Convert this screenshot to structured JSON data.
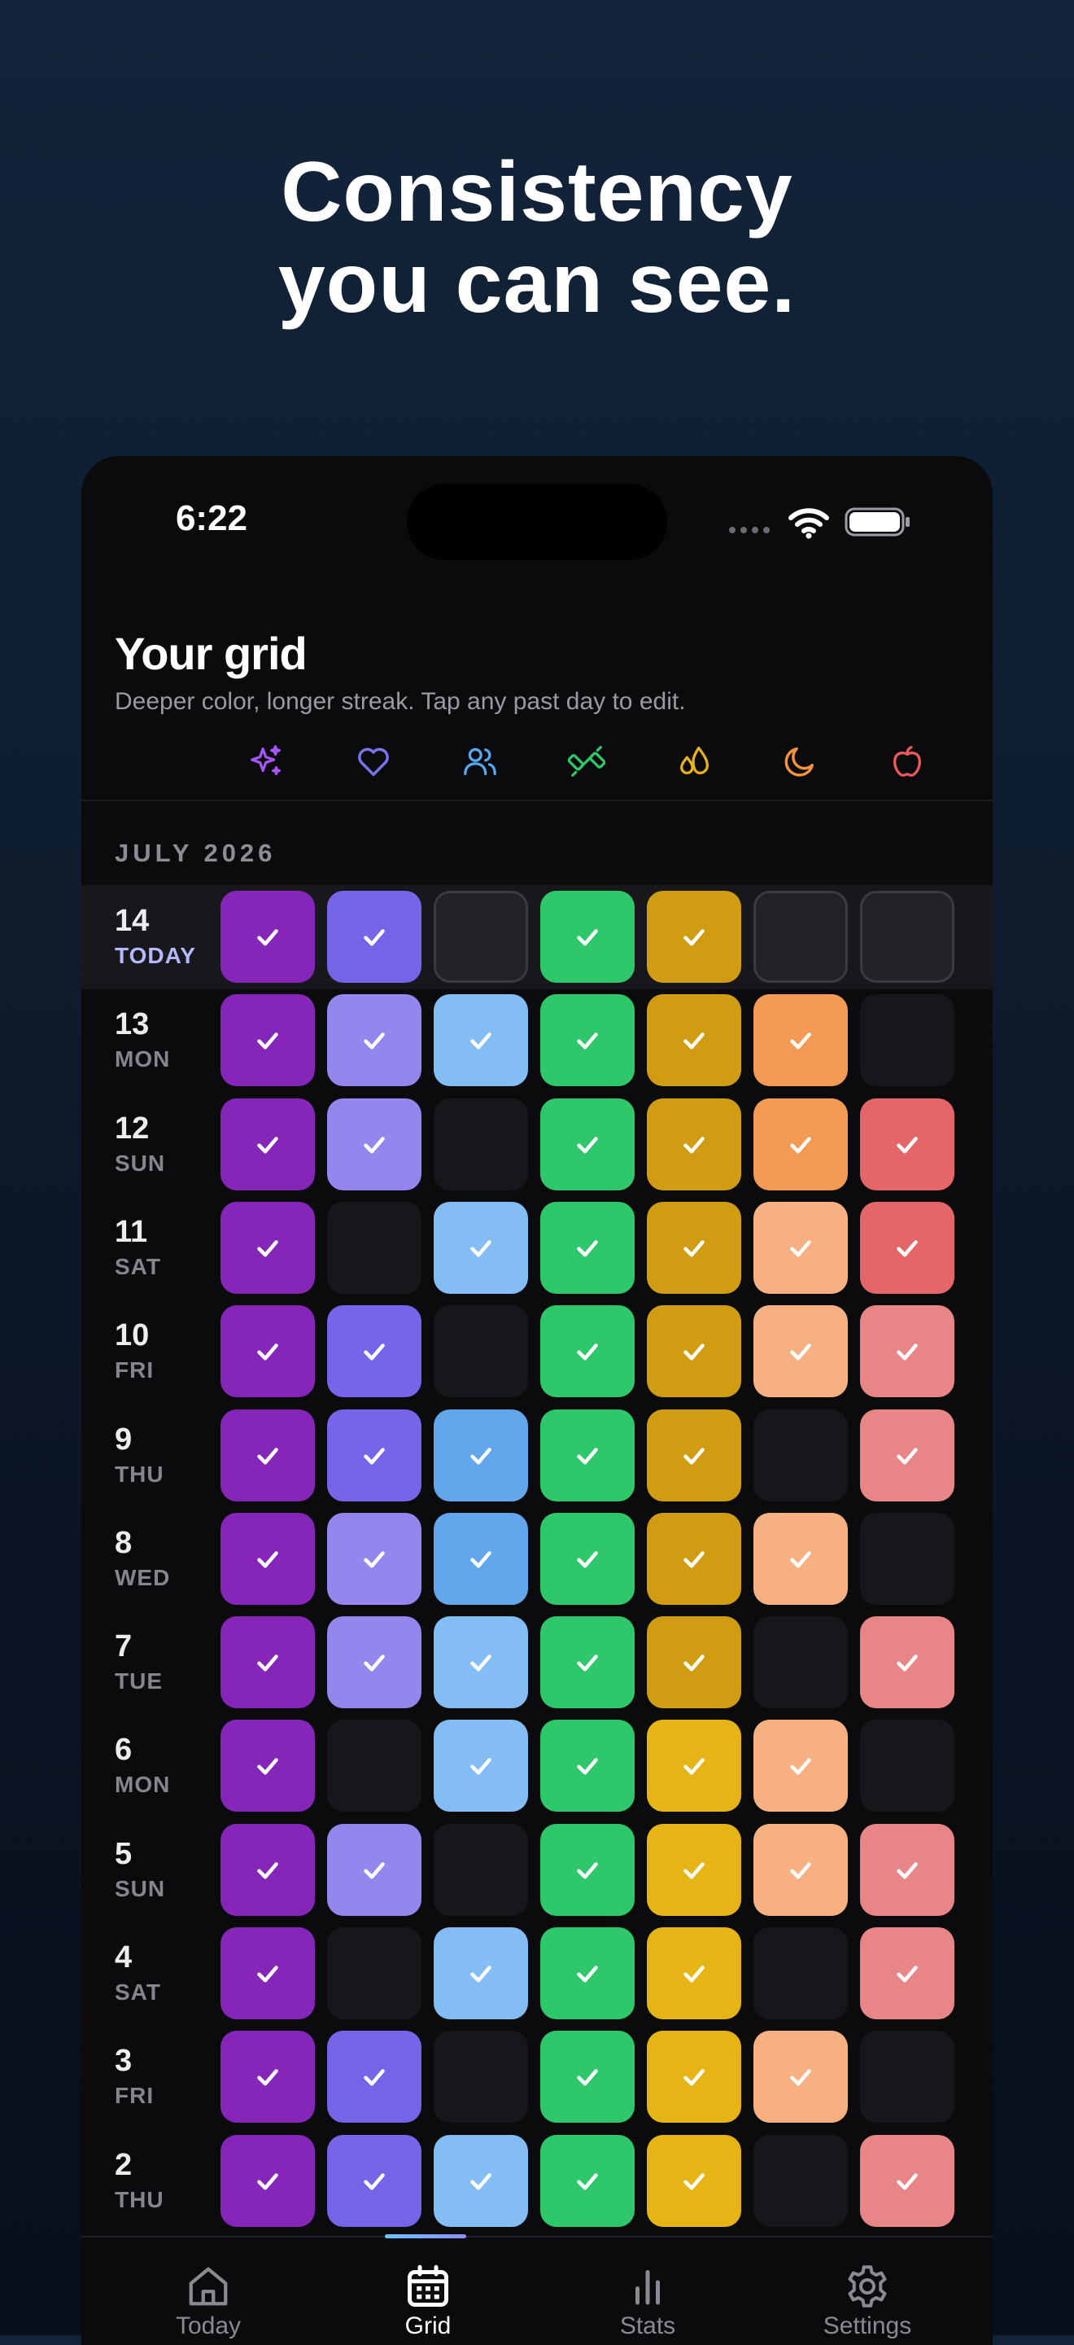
{
  "headline": {
    "line1": "Consistency",
    "line2": "you can see."
  },
  "status_bar": {
    "time": "6:22",
    "icons": [
      "cellular-dots-icon",
      "wifi-icon",
      "battery-icon"
    ]
  },
  "screen": {
    "title": "Your grid",
    "subtitle": "Deeper color, longer streak. Tap any past day to edit.",
    "month": "JULY 2026"
  },
  "habits": [
    {
      "icon": "sparkles-icon",
      "color": "#a855f7"
    },
    {
      "icon": "heart-icon",
      "color": "#7b74f0"
    },
    {
      "icon": "people-icon",
      "color": "#58a8f0"
    },
    {
      "icon": "dumbbell-icon",
      "color": "#2ec86a"
    },
    {
      "icon": "drops-icon",
      "color": "#e8b418"
    },
    {
      "icon": "moon-icon",
      "color": "#f6933c"
    },
    {
      "icon": "apple-icon",
      "color": "#ee5a5a"
    }
  ],
  "palette": {
    "P": "#8526b8",
    "I": "#7565e8",
    "L": "#9387ee",
    "B": "#84bdf3",
    "b": "#62a6ec",
    "G": "#2ec86a",
    "Y": "#cf9c12",
    "y": "#e7b416",
    "O": "#f39a54",
    "o": "#f7b081",
    "R": "#e46668",
    "r": "#e88587",
    "empty": "#17171b",
    "empty_today": "#222227"
  },
  "days": [
    {
      "num": "14",
      "name": "TODAY",
      "today": true,
      "cells": [
        "P",
        "I",
        "-",
        "G",
        "Y",
        "-",
        "-"
      ]
    },
    {
      "num": "13",
      "name": "MON",
      "cells": [
        "P",
        "L",
        "B",
        "G",
        "Y",
        "O",
        "-"
      ]
    },
    {
      "num": "12",
      "name": "SUN",
      "cells": [
        "P",
        "L",
        "-",
        "G",
        "Y",
        "O",
        "R"
      ]
    },
    {
      "num": "11",
      "name": "SAT",
      "cells": [
        "P",
        "-",
        "B",
        "G",
        "Y",
        "o",
        "R"
      ]
    },
    {
      "num": "10",
      "name": "FRI",
      "cells": [
        "P",
        "I",
        "-",
        "G",
        "Y",
        "o",
        "r"
      ]
    },
    {
      "num": "9",
      "name": "THU",
      "cells": [
        "P",
        "I",
        "b",
        "G",
        "Y",
        "-",
        "r"
      ]
    },
    {
      "num": "8",
      "name": "WED",
      "cells": [
        "P",
        "L",
        "b",
        "G",
        "Y",
        "o",
        "-"
      ]
    },
    {
      "num": "7",
      "name": "TUE",
      "cells": [
        "P",
        "L",
        "B",
        "G",
        "Y",
        "-",
        "r"
      ]
    },
    {
      "num": "6",
      "name": "MON",
      "cells": [
        "P",
        "-",
        "B",
        "G",
        "y",
        "o",
        "-"
      ]
    },
    {
      "num": "5",
      "name": "SUN",
      "cells": [
        "P",
        "L",
        "-",
        "G",
        "y",
        "o",
        "r"
      ]
    },
    {
      "num": "4",
      "name": "SAT",
      "cells": [
        "P",
        "-",
        "B",
        "G",
        "y",
        "-",
        "r"
      ]
    },
    {
      "num": "3",
      "name": "FRI",
      "cells": [
        "P",
        "I",
        "-",
        "G",
        "y",
        "o",
        "-"
      ]
    },
    {
      "num": "2",
      "name": "THU",
      "cells": [
        "P",
        "I",
        "B",
        "G",
        "y",
        "-",
        "r"
      ]
    }
  ],
  "tabs": [
    {
      "label": "Today",
      "icon": "home-icon",
      "active": false
    },
    {
      "label": "Grid",
      "icon": "calendar-icon",
      "active": true
    },
    {
      "label": "Stats",
      "icon": "bar-chart-icon",
      "active": false
    },
    {
      "label": "Settings",
      "icon": "gear-icon",
      "active": false
    }
  ]
}
